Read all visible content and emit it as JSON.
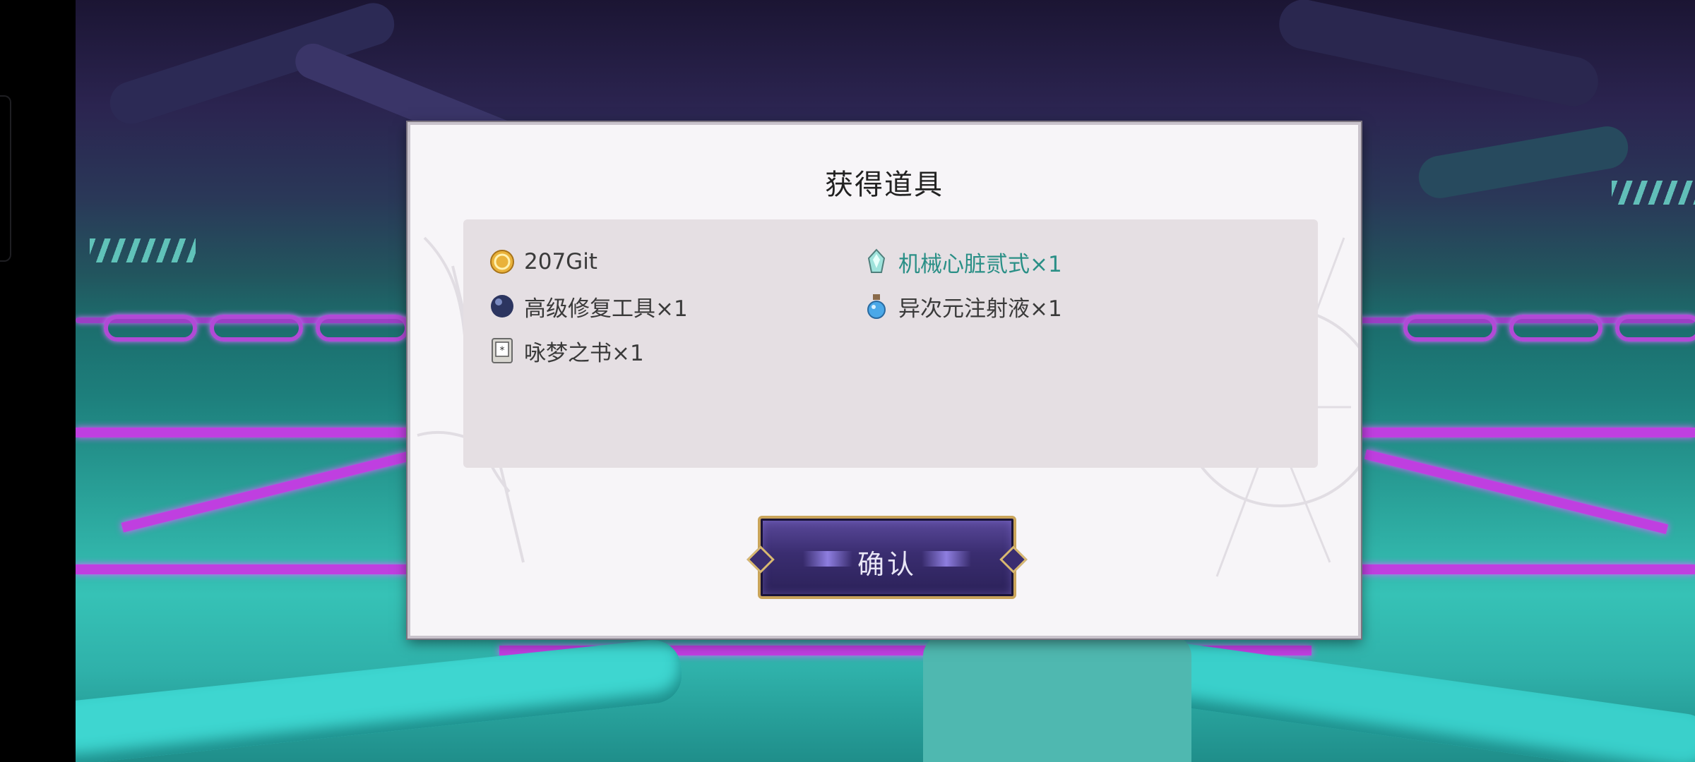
{
  "dialog": {
    "title": "获得道具",
    "items": [
      {
        "icon": "gold-coin-icon",
        "label": "207Git",
        "highlight": false
      },
      {
        "icon": "crystal-heart-icon",
        "label": "机械心脏贰式×1",
        "highlight": true
      },
      {
        "icon": "dark-orb-icon",
        "label": "高级修复工具×1",
        "highlight": false
      },
      {
        "icon": "potion-bottle-icon",
        "label": "异次元注射液×1",
        "highlight": false
      },
      {
        "icon": "book-icon",
        "label": "咏梦之书×1",
        "highlight": false
      }
    ],
    "confirm_label": "确认"
  },
  "colors": {
    "highlight_text": "#2a8f86",
    "panel_bg": "#e5dfe3",
    "button_bg": "#3a2d70",
    "button_border": "#c9a45a",
    "neon_magenta": "#bf3fe0"
  }
}
